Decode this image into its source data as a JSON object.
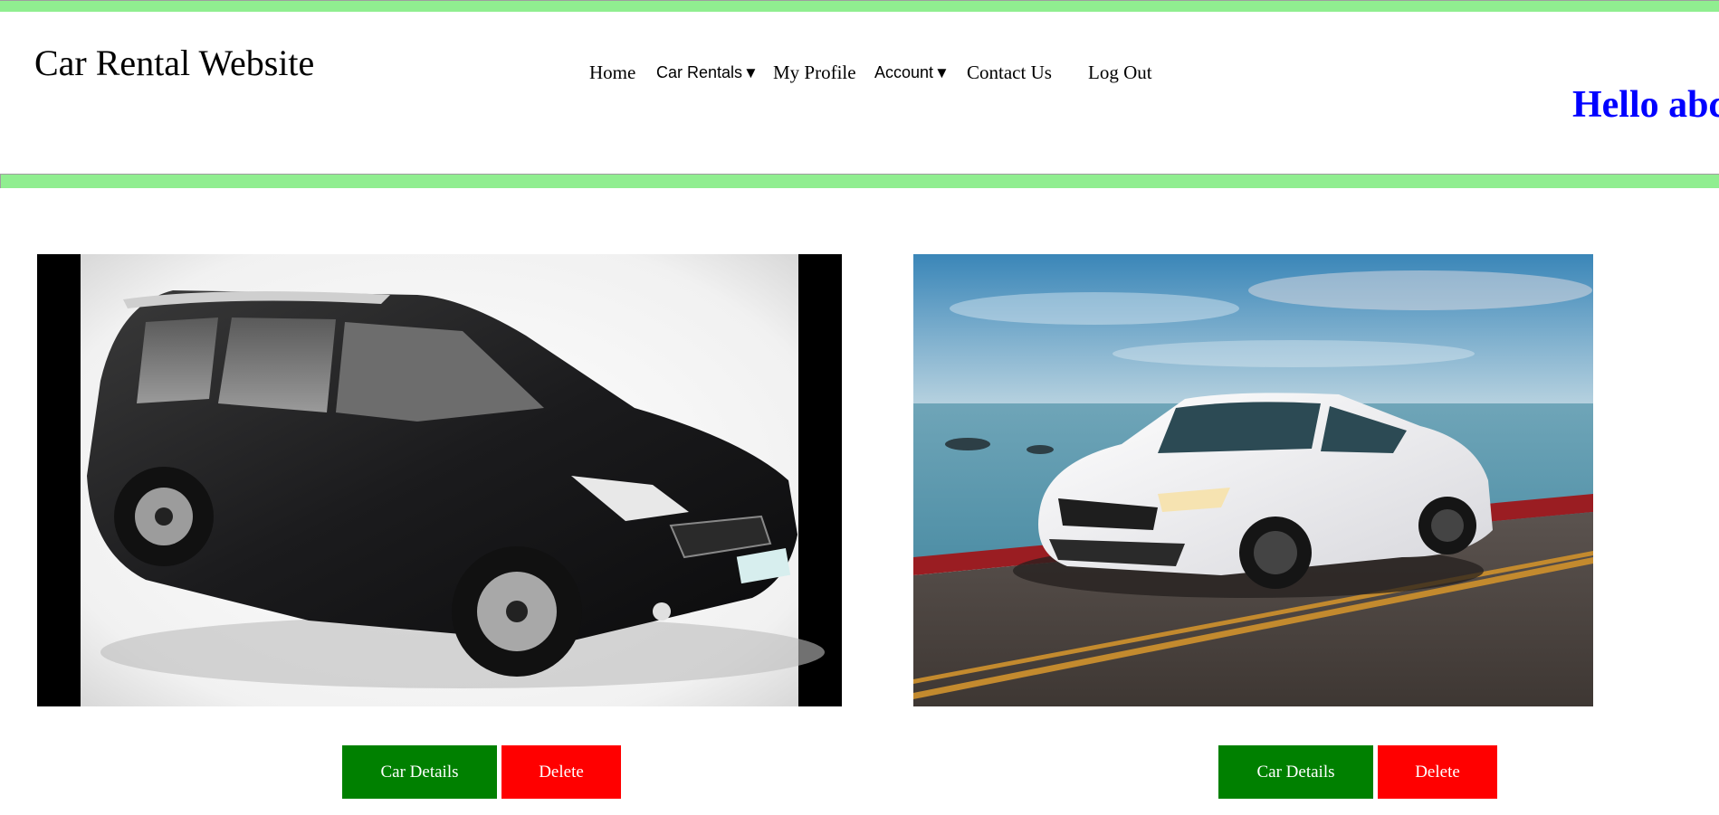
{
  "header": {
    "site_title": "Car Rental Website",
    "greeting": "Hello abc",
    "nav": [
      {
        "label": "Home"
      },
      {
        "label": "Car Rentals",
        "caret": "▼"
      },
      {
        "label": "My Profile"
      },
      {
        "label": "Account",
        "caret": "▼"
      },
      {
        "label": "Contact Us"
      },
      {
        "label": "Log Out"
      }
    ]
  },
  "cars": [
    {
      "image": "black-honda-mpv-photo",
      "details_label": "Car Details",
      "delete_label": "Delete"
    },
    {
      "image": "white-kia-sedan-on-coastal-road-photo",
      "details_label": "Car Details",
      "delete_label": "Delete"
    }
  ],
  "colors": {
    "accent_bar": "#90ee90",
    "greeting": "#0000ff",
    "details_button": "#008000",
    "delete_button": "#ff0000"
  }
}
